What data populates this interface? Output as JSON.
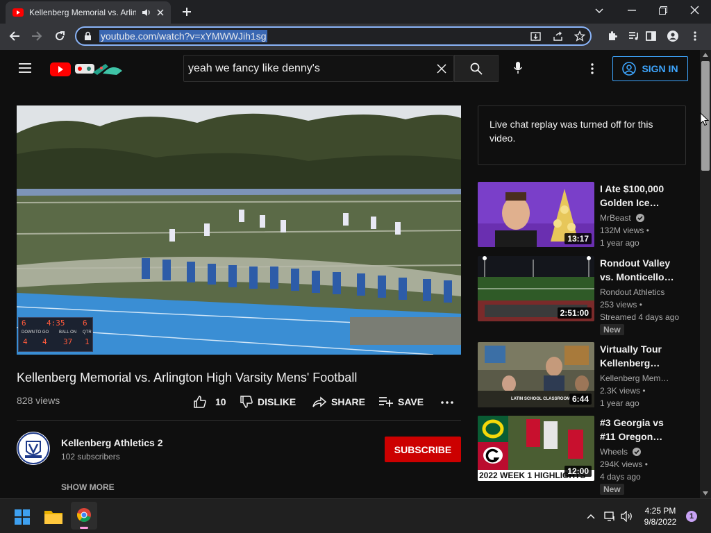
{
  "browser": {
    "tab_title": "Kellenberg Memorial vs. Arlin",
    "url": "youtube.com/watch?v=xYMWWJih1sg",
    "window_controls": [
      "chevron-down-icon",
      "minimize-icon",
      "restore-icon",
      "close-icon"
    ]
  },
  "youtube": {
    "search_query": "yeah we fancy like denny's",
    "sign_in_label": "SIGN IN"
  },
  "video": {
    "title": "Kellenberg Memorial vs. Arlington High Varsity Mens' Football",
    "views": "828 views",
    "like_count": "10",
    "dislike_label": "DISLIKE",
    "share_label": "SHARE",
    "save_label": "SAVE",
    "scoreboard": {
      "label1": "DOWN",
      "label2": "TO GO",
      "label3": "BALL ON",
      "label4": "QTR",
      "home": "6",
      "time": "4:35",
      "qtr": "6",
      "v1": "4",
      "v2": "4",
      "v3": "37",
      "v4": "1"
    }
  },
  "channel": {
    "name": "Kellenberg Athletics 2",
    "subscribers": "102 subscribers",
    "subscribe_label": "SUBSCRIBE",
    "show_more_label": "SHOW MORE"
  },
  "chat": {
    "message": "Live chat replay was turned off for this video."
  },
  "recommendations": [
    {
      "title": "I Ate $100,000 Golden Ice…",
      "channel": "MrBeast",
      "verified": true,
      "views": "132M views",
      "age": "1 year ago",
      "duration": "13:17",
      "badge": ""
    },
    {
      "title": "Rondout Valley vs. Monticello…",
      "channel": "Rondout Athletics",
      "verified": false,
      "views": "253 views",
      "age": "Streamed 4 days ago",
      "duration": "2:51:00",
      "badge": "New"
    },
    {
      "title": "Virtually Tour Kellenberg…",
      "channel": "Kellenberg Mem…",
      "verified": false,
      "views": "2.3K views",
      "age": "1 year ago",
      "duration": "6:44",
      "badge": "",
      "thumb_caption": "LATIN SCHOOL CLASSROOM"
    },
    {
      "title": "#3 Georgia vs #11 Oregon…",
      "channel": "Wheels",
      "verified": true,
      "views": "294K views",
      "age": "4 days ago",
      "duration": "12:00",
      "badge": "New",
      "thumb_caption": "2022 WEEK 1 HIGHLIGHTS"
    }
  ],
  "taskbar": {
    "time": "4:25 PM",
    "date": "9/8/2022",
    "notification_count": "1"
  },
  "colors": {
    "accent": "#3ea6ff",
    "subscribe": "#cc0000",
    "youtube_red": "#ff0000",
    "omnibox_focus": "#8ab4f8"
  }
}
